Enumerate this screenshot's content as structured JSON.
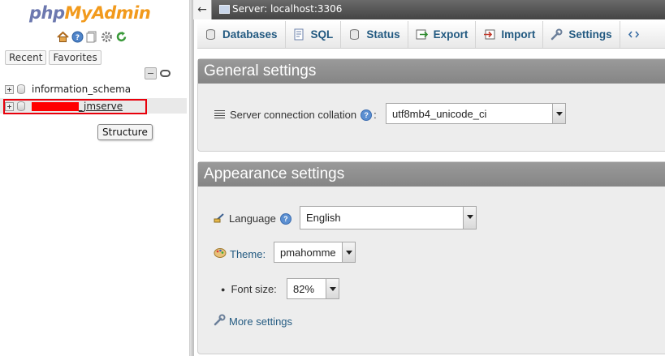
{
  "navigation": {
    "logo": {
      "part1": "php",
      "part2": "MyAdmin"
    },
    "quick_icons": [
      "home-icon",
      "help-icon",
      "documentation-icon",
      "settings-gear-icon",
      "reload-icon"
    ],
    "tabs": {
      "recent": "Recent",
      "favorites": "Favorites"
    },
    "databases": [
      {
        "name": "information_schema"
      },
      {
        "name_visible_suffix": "_jmserve",
        "redacted_prefix": true
      }
    ],
    "tooltip": "Structure",
    "highlight_color": "#e8000b"
  },
  "topbar": {
    "back_symbol": "←",
    "server_label": "Server: localhost:3306"
  },
  "tabs": [
    {
      "label": "Databases",
      "icon": "database-icon"
    },
    {
      "label": "SQL",
      "icon": "sql-icon"
    },
    {
      "label": "Status",
      "icon": "status-icon"
    },
    {
      "label": "Export",
      "icon": "export-icon"
    },
    {
      "label": "Import",
      "icon": "import-icon"
    },
    {
      "label": "Settings",
      "icon": "wrench-icon"
    },
    {
      "label": "",
      "icon": "more-icon"
    }
  ],
  "general_settings": {
    "title": "General settings",
    "collation_label": "Server connection collation",
    "collation_colon": ":",
    "collation_value": "utf8mb4_unicode_ci"
  },
  "appearance_settings": {
    "title": "Appearance settings",
    "language_label": "Language",
    "language_value": "English",
    "theme_label": "Theme:",
    "theme_value": "pmahomme",
    "font_size_label": "Font size:",
    "font_size_value": "82%",
    "more_settings_label": "More settings"
  },
  "colors": {
    "link": "#235a81",
    "group_header": "#8f8f8f",
    "logo_php": "#6c78af",
    "logo_myadmin": "#f29a1c"
  }
}
